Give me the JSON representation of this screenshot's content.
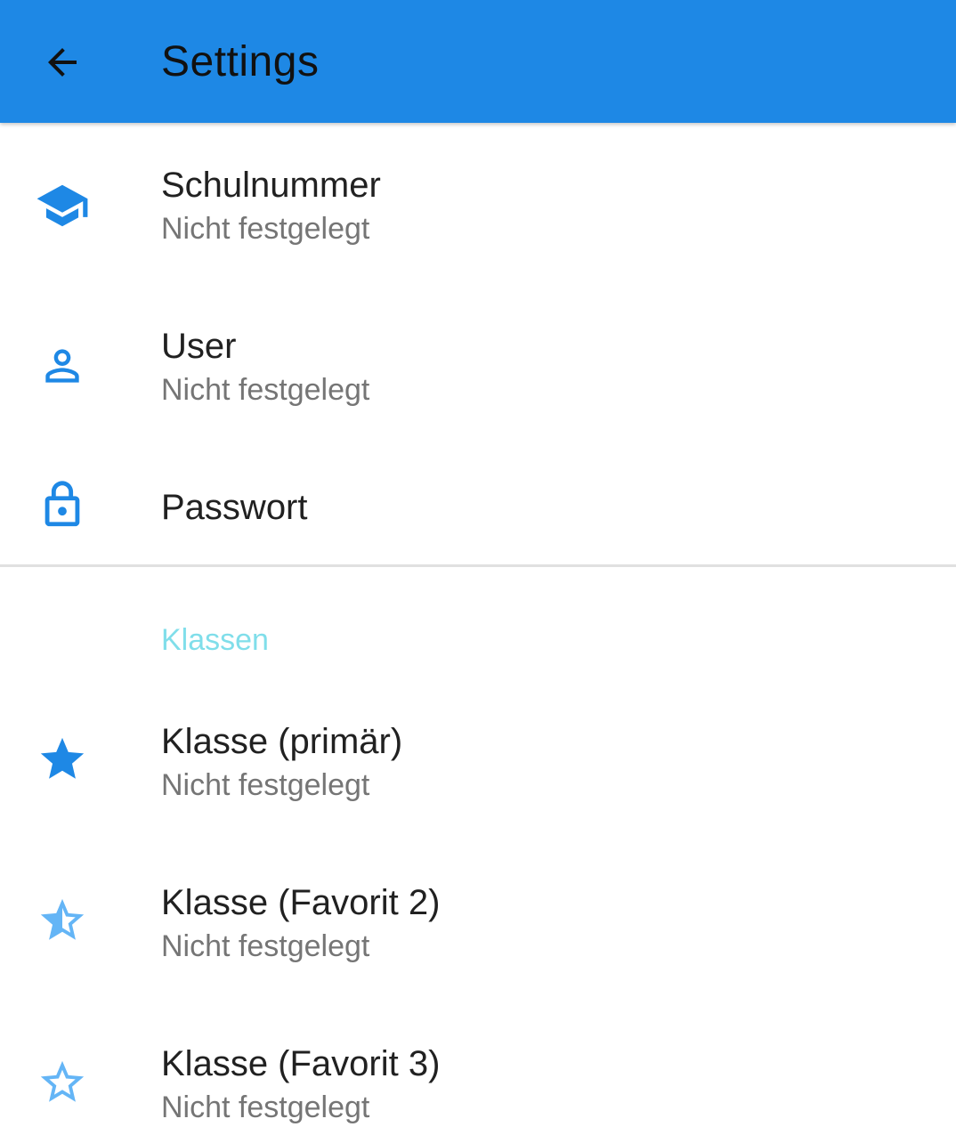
{
  "appbar": {
    "title": "Settings",
    "back_icon": "arrow-back-icon",
    "color": "#1e88e5"
  },
  "settings": [
    {
      "icon": "school-icon",
      "title": "Schulnummer",
      "subtitle": "Nicht festgelegt"
    },
    {
      "icon": "person-outline-icon",
      "title": "User",
      "subtitle": "Nicht festgelegt"
    },
    {
      "icon": "lock-icon",
      "title": "Passwort"
    }
  ],
  "classes_section": {
    "header": "Klassen",
    "header_color": "#80deea",
    "items": [
      {
        "icon": "star-filled-icon",
        "title": "Klasse (primär)",
        "subtitle": "Nicht festgelegt"
      },
      {
        "icon": "star-half-icon",
        "title": "Klasse (Favorit 2)",
        "subtitle": "Nicht festgelegt"
      },
      {
        "icon": "star-outline-icon",
        "title": "Klasse (Favorit 3)",
        "subtitle": "Nicht festgelegt"
      }
    ]
  },
  "colors": {
    "icon_primary": "#1e88e5",
    "icon_light": "#64b5f6"
  }
}
